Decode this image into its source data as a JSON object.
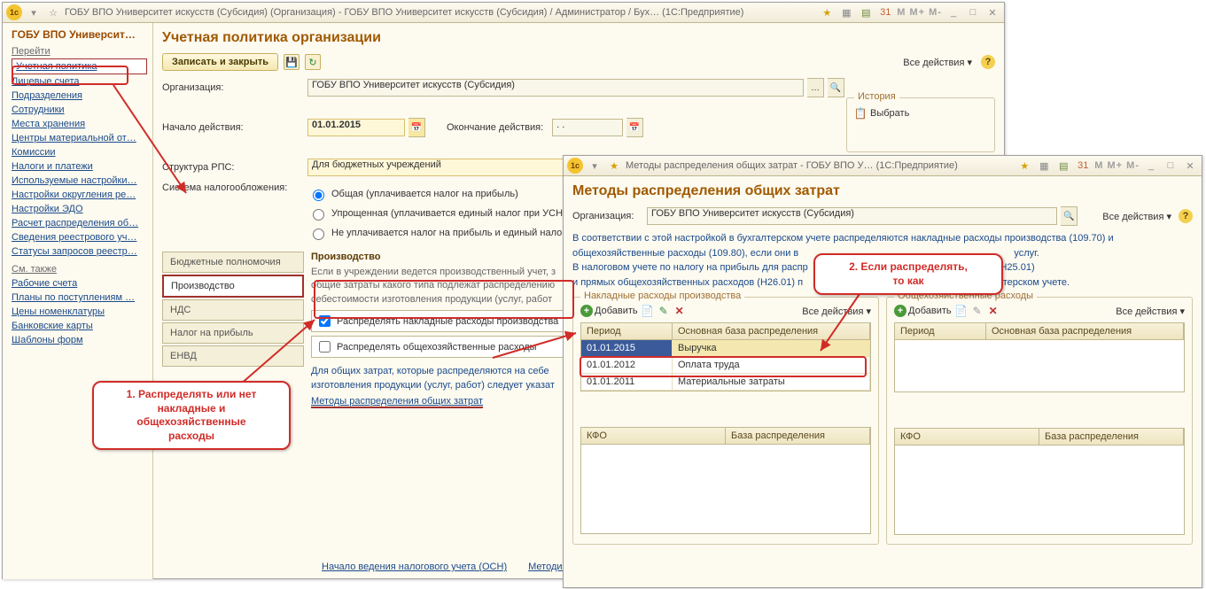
{
  "win1": {
    "title": "ГОБУ ВПО Университет искусств (Субсидия) (Организация) - ГОБУ ВПО Университет искусств (Субсидия) / Администратор / Бух…  (1С:Предприятие)",
    "mbuttons": "M  M+  M-",
    "sidebar": {
      "title": "ГОБУ ВПО Университ…",
      "section1": "Перейти",
      "active": "Учетная политика",
      "items": [
        "Лицевые счета",
        "Подразделения",
        "Сотрудники",
        "Места хранения",
        "Центры материальной от…",
        "Комиссии",
        "Налоги и платежи",
        "Используемые настройки…",
        "Настройки округления ре…",
        "Настройки ЭДО",
        "Расчет распределения об…",
        "Сведения реестрового уч…",
        "Статусы запросов реестр…"
      ],
      "section2": "См. также",
      "items2": [
        "Рабочие счета",
        "Планы по поступлениям …",
        "Цены номенклатуры",
        "Банковские карты",
        "Шаблоны форм"
      ]
    },
    "page": {
      "title": "Учетная политика организации",
      "save": "Записать и закрыть",
      "all_actions": "Все действия ▾",
      "org_label": "Организация:",
      "org_value": "ГОБУ ВПО Университет искусств (Субсидия)",
      "start_label": "Начало действия:",
      "start_value": "01.01.2015",
      "end_label": "Окончание действия:",
      "end_value": ". .",
      "rps_label": "Структура РПС:",
      "rps_value": "Для бюджетных учреждений",
      "tax_label": "Система налогообложения:",
      "tax_r1": "Общая (уплачивается налог на прибыль)",
      "tax_r2": "Упрощенная (уплачивается единый налог при УСН)",
      "tax_r3": "Не уплачивается налог на прибыль и единый налог при",
      "history_title": "История",
      "history_btn": "Выбрать",
      "tabs": [
        "Бюджетные полномочия",
        "Производство",
        "НДС",
        "Налог на прибыль",
        "ЕНВД"
      ],
      "body_title": "Производство",
      "body_desc": "Если в учреждении ведется производственный учет, з\nобщие затраты какого типа подлежат распределению\nсебестоимости изготовления продукции (услуг, работ",
      "cb1": "Распределять накладные расходы производства",
      "cb2": "Распределять общехозяйственные расходы",
      "note": "Для общих затрат, которые распределяются на себе\nизготовления продукции (услуг, работ) следует указат",
      "methods_link": "Методы распределения общих затрат",
      "foot1": "Начало ведения налогового учета (ОСН)",
      "foot2": "Методика ведения налогового учета "
    }
  },
  "win2": {
    "title": "Методы распределения общих затрат - ГОБУ ВПО У…  (1С:Предприятие)",
    "mbuttons": "M  M+  M-",
    "page_title": "Методы распределения общих затрат",
    "all_actions": "Все действия ▾",
    "org_label": "Организация:",
    "org_value": "ГОБУ ВПО Университет искусств (Субсидия)",
    "info1": "В соответствии с этой настройкой в бухгалтерском учете распределяются накладные расходы производства (109.70) и общехозяйственные расходы (109.80), если они в",
    "info1b": "услуг.",
    "info2a": "В налоговом учете по налогу на прибыль для распр",
    "info2b": "(Н25.01)",
    "info2c": "и прямых общехозяйственных расходов (Н26.01) п",
    "info2d": "алтерском учете.",
    "panel1_title": "Накладные расходы производства",
    "panel2_title": "Общехозяйственные расходы",
    "add": "Добавить",
    "panel_actions": "Все действия ▾",
    "col_period": "Период",
    "col_base": "Основная база распределения",
    "rows": [
      {
        "p": "01.01.2015",
        "b": "Выручка"
      },
      {
        "p": "01.01.2012",
        "b": "Оплата труда"
      },
      {
        "p": "01.01.2011",
        "b": "Материальные затраты"
      }
    ],
    "col_kfo": "КФО",
    "col_base2": "База распределения"
  },
  "callouts": {
    "c1": "1. Распределять или нет\nнакладные и\nобщехозяйственные\nрасходы",
    "c2": "2. Если распределять,\nто как"
  }
}
